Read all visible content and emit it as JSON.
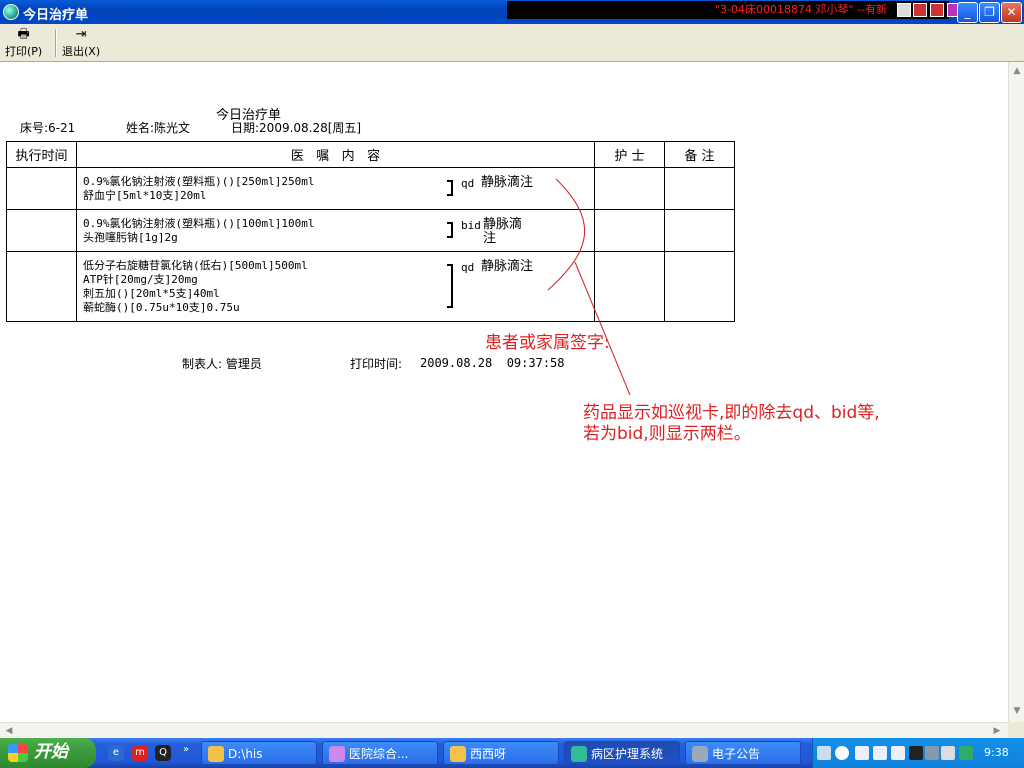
{
  "window": {
    "title": "今日治疗单",
    "ticker": "\"3-04床00018874 邓小琴\" --有新",
    "colors": {
      "titlebar": "#0048c8",
      "ticker_text": "#ff2222",
      "annotation": "#e02020"
    }
  },
  "toolbar": {
    "print_label": "打印(P)",
    "exit_label": "退出(X)"
  },
  "document": {
    "title": "今日治疗单",
    "bed": "床号:6-21",
    "name": "姓名:陈光文",
    "date": "日期:2009.08.28[周五]",
    "columns": [
      "执行时间",
      "医   嘱   内   容",
      "护 士",
      "备 注"
    ],
    "rows": [
      {
        "time": "",
        "lines": [
          "0.9%氯化钠注射液(塑料瓶)()[250ml]250ml",
          "舒血宁[5ml*10支]20ml"
        ],
        "freq": "qd",
        "route": "静脉滴注",
        "nurse": "",
        "note": ""
      },
      {
        "time": "",
        "lines": [
          "0.9%氯化钠注射液(塑料瓶)()[100ml]100ml",
          "头孢噻肟钠[1g]2g"
        ],
        "freq": "bid",
        "route": "静脉滴注",
        "nurse": "",
        "note": ""
      },
      {
        "time": "",
        "lines": [
          "低分子右旋糖苷氯化钠(低右)[500ml]500ml",
          "ATP针[20mg/支]20mg",
          "刺五加()[20ml*5支]40ml",
          "蕲蛇酶()[0.75u*10支]0.75u"
        ],
        "freq": "qd",
        "route": "静脉滴注",
        "nurse": "",
        "note": ""
      }
    ],
    "maker": "制表人: 管理员",
    "print_time_label": "打印时间:",
    "print_time": "2009.08.28  09:37:58",
    "annotation_signature": "患者或家属签字:",
    "annotation_note": "药品显示如巡视卡,即的除去qd、bid等,若为bid,则显示两栏。"
  },
  "taskbar": {
    "start_label": "开始",
    "tasks": [
      "D:\\his",
      "医院综合...",
      "西西呀",
      "病区护理系统",
      "电子公告"
    ],
    "clock": "9:38"
  }
}
